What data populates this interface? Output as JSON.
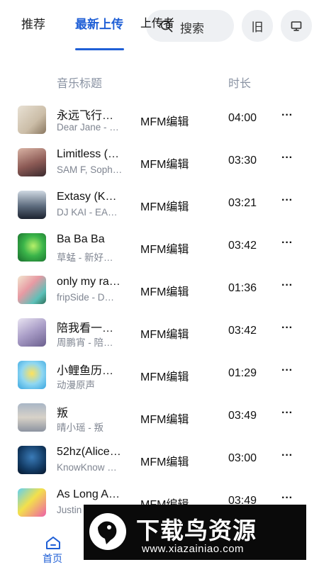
{
  "tabs": {
    "recommend": "推荐",
    "latest": "最新上传"
  },
  "search": {
    "placeholder": "搜索"
  },
  "buttons": {
    "old": "旧",
    "screen_icon": "monitor-icon"
  },
  "columns": {
    "title": "音乐标题",
    "uploader": "上传者",
    "duration": "时长"
  },
  "songs": [
    {
      "title": "永远飞行…",
      "artist": "Dear Jane - …",
      "uploader": "MFM编辑",
      "duration": "04:00",
      "more": "···"
    },
    {
      "title": "Limitless (…",
      "artist": "SAM F, Soph…",
      "uploader": "MFM编辑",
      "duration": "03:30",
      "more": "···"
    },
    {
      "title": "Extasy (K…",
      "artist": "DJ KAI - EA…",
      "uploader": "MFM编辑",
      "duration": "03:21",
      "more": "···"
    },
    {
      "title": "Ba Ba Ba",
      "artist": "草蜢 - 新好…",
      "uploader": "MFM编辑",
      "duration": "03:42",
      "more": "···"
    },
    {
      "title": "only my ra…",
      "artist": "fripSide - D…",
      "uploader": "MFM编辑",
      "duration": "01:36",
      "more": "···"
    },
    {
      "title": "陪我看一…",
      "artist": "周鹏宵 - 陪…",
      "uploader": "MFM编辑",
      "duration": "03:42",
      "more": "···"
    },
    {
      "title": "小鲤鱼历…",
      "artist": "动漫原声",
      "uploader": "MFM编辑",
      "duration": "01:29",
      "more": "···"
    },
    {
      "title": "叛",
      "artist": "晴小瑶 - 叛",
      "uploader": "MFM编辑",
      "duration": "03:49",
      "more": "···"
    },
    {
      "title": "52hz(Alice…",
      "artist": "KnowKnow …",
      "uploader": "MFM编辑",
      "duration": "03:00",
      "more": "···"
    },
    {
      "title": "As Long A…",
      "artist": "Justin",
      "uploader": "MFM编辑",
      "duration": "03:49",
      "more": "···"
    }
  ],
  "bottom_nav": {
    "home": "首页"
  },
  "watermark": {
    "title": "下载鸟资源",
    "url": "www.xiazainiao.com"
  },
  "colors": {
    "accent": "#1f5fd6",
    "muted": "#8a93a3",
    "pill": "#eef0f3"
  }
}
